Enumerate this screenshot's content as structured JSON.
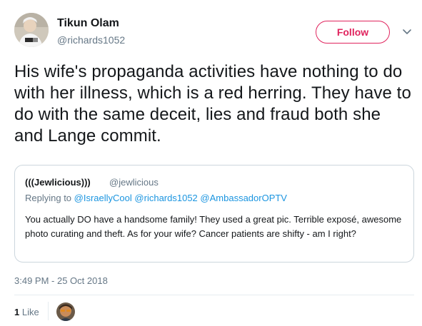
{
  "author": {
    "display_name": "Tikun Olam",
    "handle": "@richards1052",
    "avatar_icon": "profile-photo-icon"
  },
  "follow_button": {
    "label": "Follow",
    "color": "#e0245e"
  },
  "menu_icon": "chevron-down-icon",
  "tweet": {
    "text": "His wife's propaganda activities have nothing to do with her illness, which is a red herring. They have to do with the same deceit, lies and fraud both she and Lange commit."
  },
  "quoted_tweet": {
    "display_name": "(((Jewlicious)))",
    "handle": "@jewlicious",
    "replying_to_label": "Replying to",
    "mentions": [
      "@IsraellyCool",
      "@richards1052",
      "@AmbassadorOPTV"
    ],
    "text": "You actually DO have a handsome family! They used a great pic. Terrible exposé, awesome photo curating and theft. As for your wife? Cancer patients are shifty - am I right?"
  },
  "timestamp": "3:49 PM - 25 Oct 2018",
  "stats": {
    "like_count": "1",
    "like_label": "Like",
    "liker_avatar_icon": "liker-avatar-icon"
  },
  "colors": {
    "text": "#14171a",
    "secondary": "#657786",
    "link": "#1b95e0",
    "border": "#ccd6dd"
  }
}
